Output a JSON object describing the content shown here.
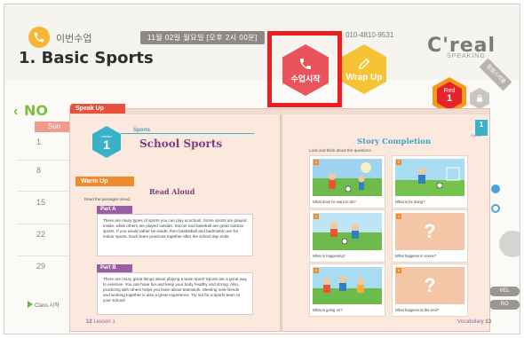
{
  "header": {
    "lesson_label": "이번수업",
    "date_time": "11월 02일 월요일 [오후 2시 00분]",
    "teacher_phone": "010-4810-9531",
    "page_title": "1. Basic Sports",
    "brand": "C'real",
    "brand_sub": "SPEAKING"
  },
  "actions": {
    "start_class_label": "수업시작",
    "wrap_up_label": "Wrap Up"
  },
  "level": {
    "name": "Red",
    "number": "1",
    "side_tab": "월별스케쥴"
  },
  "calendar": {
    "month": "NO",
    "day_header": "Sun",
    "dates": [
      "1",
      "8",
      "15",
      "22",
      "29"
    ],
    "class_info": "Class 시작"
  },
  "right_side": {
    "buttons": [
      "VEL",
      "RO"
    ]
  },
  "book": {
    "section_tab": "Speak Up",
    "lesson_small": "Lesson",
    "lesson_number": "1",
    "category": "Sports",
    "left_title": "School Sports",
    "warm_up": "Warm Up",
    "read_aloud": "Read Aloud",
    "read_instruction": "Read the passages aloud.",
    "part_a": {
      "label": "Part A",
      "text": "There are many types of sports you can play at school. Some sports are played inside, while others are played outside. Soccer and baseball are great outdoor sports. If you would rather be inside, then basketball and badminton are for indoor sports. Each team practices together after the school day ends."
    },
    "part_b": {
      "label": "Part B",
      "text": "There are many great things about playing a team sport! Sports are a great way to exercise. You can have fun and keep your body healthy and strong. Also, practicing with others helps you learn about teamwork. Meeting new friends and working together is also a great experience. Try out for a sports team at your school!"
    },
    "page_left": "12",
    "page_left_label": "Lesson 1",
    "page_right": "13",
    "page_right_label": "Vocabulary",
    "right_title": "Story Completion",
    "right_instruction": "Look and think about the questions.",
    "corner_number": "1",
    "corner_label": "Sports",
    "panels": [
      {
        "num": "1",
        "caption": "What does he want to do?",
        "image": "soccer-field"
      },
      {
        "num": "2",
        "caption": "What is he doing?",
        "image": "soccer-kick"
      },
      {
        "num": "3",
        "caption": "What is happening?",
        "image": "soccer-collision"
      },
      {
        "num": "4",
        "caption": "What happens in scene?",
        "image": "question"
      },
      {
        "num": "5",
        "caption": "What is going on?",
        "image": "soccer-team"
      },
      {
        "num": "6",
        "caption": "What happens at the end?",
        "image": "question"
      }
    ]
  },
  "colors": {
    "highlight": "#ee1d23",
    "start_hex": "#e9535c",
    "wrap_hex": "#f6c334",
    "calendar_accent": "#7fbf3f",
    "lesson_purple": "#7b3d85",
    "teal": "#3bb0c9"
  }
}
